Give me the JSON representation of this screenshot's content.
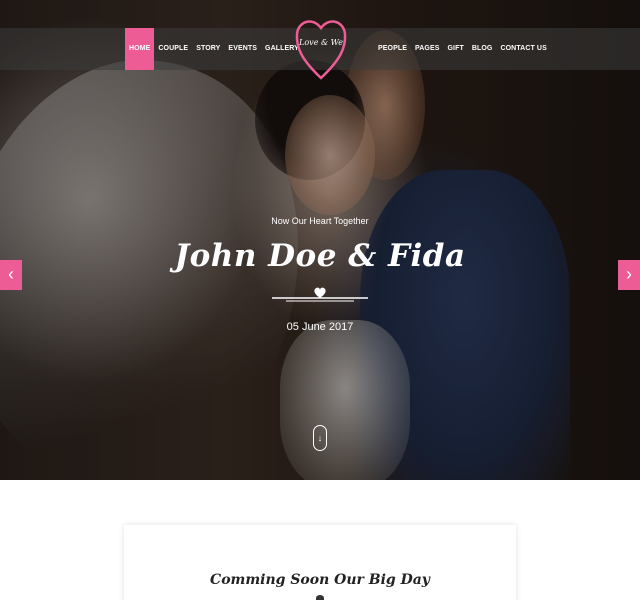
{
  "nav": {
    "left_items": [
      {
        "label": "HOME",
        "active": true
      },
      {
        "label": "COUPLE",
        "active": false
      },
      {
        "label": "STORY",
        "active": false
      },
      {
        "label": "EVENTS",
        "active": false
      },
      {
        "label": "GALLERY",
        "active": false
      }
    ],
    "right_items": [
      {
        "label": "PEOPLE"
      },
      {
        "label": "PAGES"
      },
      {
        "label": "GIFT"
      },
      {
        "label": "BLOG"
      },
      {
        "label": "CONTACT US"
      }
    ]
  },
  "logo": {
    "text": "Love & We",
    "icon": "heart-outline-icon"
  },
  "hero": {
    "tagline": "Now Our Heart Together",
    "names": "John Doe & Fida",
    "date": "05 June 2017",
    "prev_icon": "chevron-left-icon",
    "next_icon": "chevron-right-icon",
    "scroll_icon": "arrow-down-icon"
  },
  "countdown": {
    "title": "Comming Soon Our Big Day"
  },
  "colors": {
    "accent": "#ee5c96",
    "nav_bg": "#3c3c3c",
    "text_light": "#ffffff"
  }
}
